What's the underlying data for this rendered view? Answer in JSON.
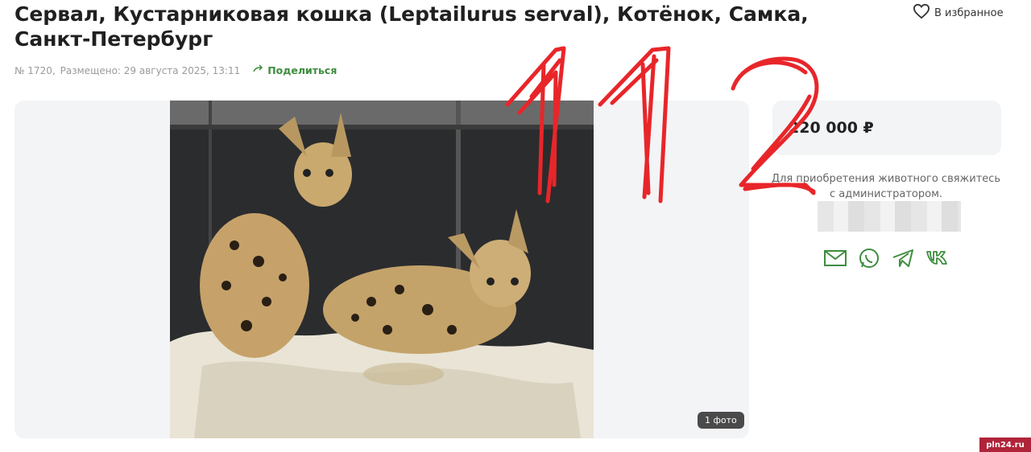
{
  "listing": {
    "title": "Сервал, Кустарниковая кошка (Leptailurus serval), Котёнок, Самка, Санкт-Петербург",
    "number": "№ 1720,",
    "posted": "Размещено: 29 августа 2025, 13:11",
    "share_label": "Поделиться",
    "favorite_label": "В избранное"
  },
  "gallery": {
    "photo_count": "1 фото"
  },
  "sidebar": {
    "price": "220 000 ₽",
    "contact_note": "Для приобретения животного свяжитесь с администратором."
  },
  "annotation": {
    "handwritten_text": "112",
    "color": "#e8262a"
  },
  "watermark": {
    "text": "pln24.ru"
  },
  "colors": {
    "accent_green": "#3e8d3e",
    "card_bg": "#f3f4f6"
  },
  "icons": [
    "heart-icon",
    "share-icon",
    "mail-icon",
    "whatsapp-icon",
    "telegram-icon",
    "vk-icon"
  ]
}
